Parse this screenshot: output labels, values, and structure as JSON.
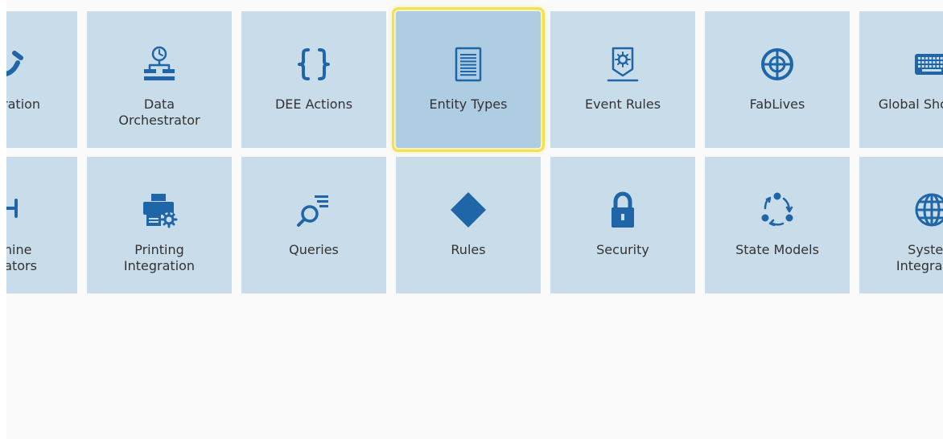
{
  "theme": {
    "tile_bg": "#c9dce9",
    "tile_selected_bg": "#aecde3",
    "selection_outline": "#f5e14d",
    "icon_color": "#1f66a8",
    "label_color": "#333333"
  },
  "tiles": [
    {
      "id": "integration",
      "icon": "integration-icon",
      "lines": [
        "Integration"
      ]
    },
    {
      "id": "data-orchestrator",
      "icon": "data-orchestrator-icon",
      "lines": [
        "Data",
        "Orchestrator"
      ]
    },
    {
      "id": "dee-actions",
      "icon": "curly-braces-icon",
      "lines": [
        "DEE Actions"
      ]
    },
    {
      "id": "entity-types",
      "icon": "document-list-icon",
      "lines": [
        "Entity Types"
      ],
      "selected": true
    },
    {
      "id": "event-rules",
      "icon": "event-rules-icon",
      "lines": [
        "Event Rules"
      ]
    },
    {
      "id": "fablives",
      "icon": "fablives-icon",
      "lines": [
        "FabLives"
      ]
    },
    {
      "id": "global-shortcuts",
      "icon": "keyboard-icon",
      "lines": [
        "Global Shortcuts"
      ]
    },
    {
      "id": "machine-operators",
      "icon": "machine-operators-icon",
      "lines": [
        "Machine",
        "Operators"
      ]
    },
    {
      "id": "printing-integration",
      "icon": "printer-gear-icon",
      "lines": [
        "Printing",
        "Integration"
      ]
    },
    {
      "id": "queries",
      "icon": "search-list-icon",
      "lines": [
        "Queries"
      ]
    },
    {
      "id": "rules",
      "icon": "diamond-icon",
      "lines": [
        "Rules"
      ]
    },
    {
      "id": "security",
      "icon": "lock-icon",
      "lines": [
        "Security"
      ]
    },
    {
      "id": "state-models",
      "icon": "state-cycle-icon",
      "lines": [
        "State Models"
      ]
    },
    {
      "id": "system-integration",
      "icon": "globe-icon",
      "lines": [
        "System",
        "Integration"
      ]
    }
  ]
}
